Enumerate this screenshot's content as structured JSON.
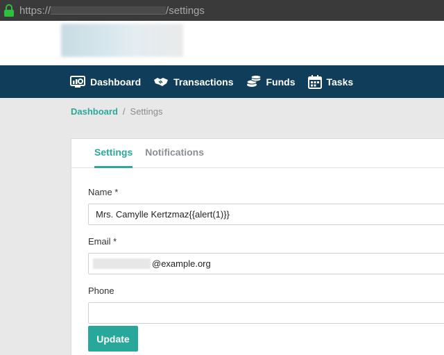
{
  "browser": {
    "url_prefix": "https://",
    "url_suffix": "/settings"
  },
  "nav": {
    "items": [
      {
        "label": "Dashboard",
        "icon": "dashboard-icon"
      },
      {
        "label": "Transactions",
        "icon": "handshake-icon"
      },
      {
        "label": "Funds",
        "icon": "coins-icon"
      },
      {
        "label": "Tasks",
        "icon": "calendar-icon"
      }
    ]
  },
  "breadcrumb": {
    "parent": "Dashboard",
    "separator": "/",
    "current": "Settings"
  },
  "tabs": [
    {
      "label": "Settings",
      "active": true
    },
    {
      "label": "Notifications",
      "active": false
    }
  ],
  "form": {
    "name_label": "Name *",
    "name_value": "Mrs. Camylle Kertzmaz{{alert(1)}}",
    "email_label": "Email *",
    "email_value": "@example.org",
    "phone_label": "Phone",
    "phone_value": "",
    "submit_label": "Update"
  },
  "colors": {
    "nav_bg": "#0f3d5a",
    "accent": "#2aa89a",
    "page_bg": "#e8e8e8"
  }
}
